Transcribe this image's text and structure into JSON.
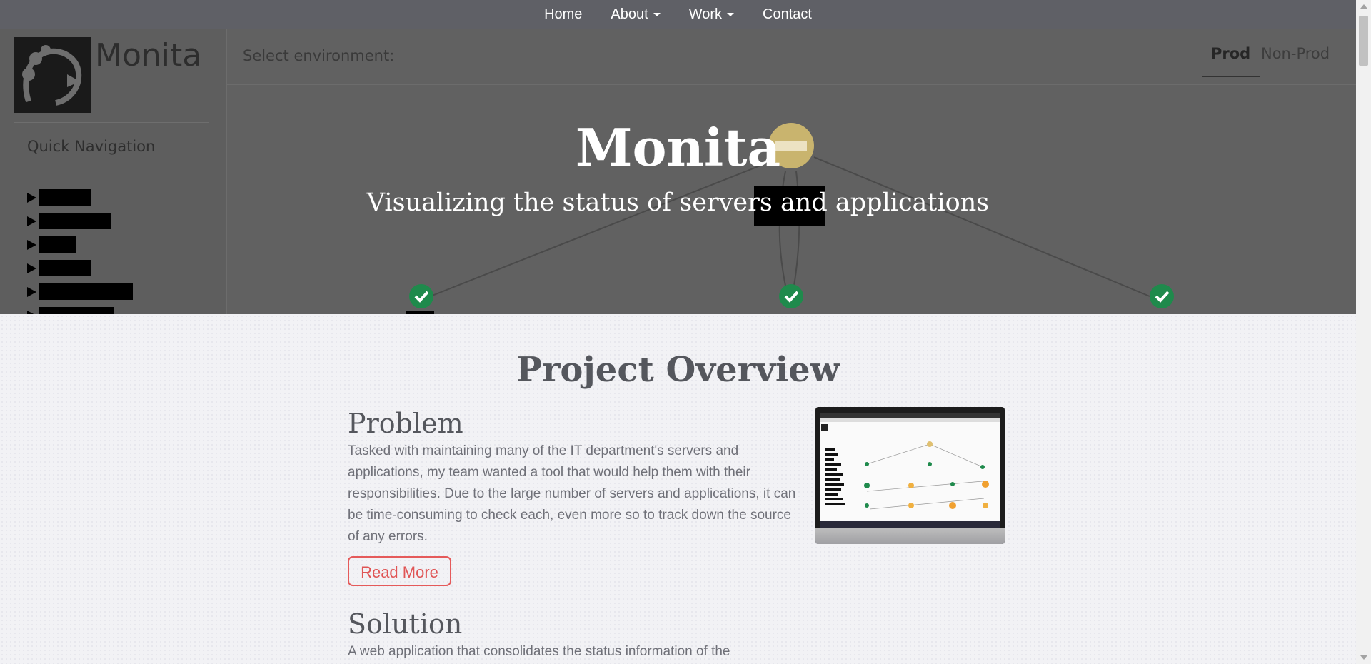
{
  "nav": {
    "home": "Home",
    "about": "About",
    "work": "Work",
    "contact": "Contact"
  },
  "hero": {
    "title": "Monita",
    "subtitle": "Visualizing the status of servers and applications",
    "app_logo_text": "Monita",
    "quick_nav_label": "Quick Navigation",
    "environment_label": "Select environment:",
    "env_tabs": {
      "prod": "Prod",
      "nonprod": "Non-Prod"
    },
    "selected_env": "Prod"
  },
  "overview": {
    "title": "Project Overview",
    "problem_title": "Problem",
    "problem_text": "Tasked with maintaining many of the IT department's servers and applications, my team wanted a tool that would help them with their responsibilities. Due to the large number of servers and applications, it can be time-consuming to check each, even more so to track down the source of any errors.",
    "read_more": "Read More",
    "solution_title": "Solution",
    "solution_text": "A web application that consolidates the status information of the"
  },
  "colors": {
    "nav_bg": "#5f6066",
    "hero_overlay": "#616161",
    "status_ok": "#1f8a4c",
    "status_blocked": "#c9b46e",
    "accent_red": "#e55a5a"
  }
}
